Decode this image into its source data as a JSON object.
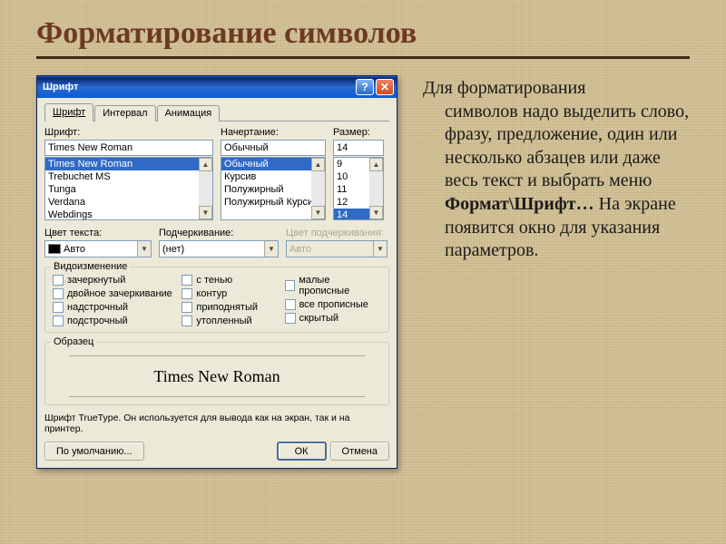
{
  "slide": {
    "title": "Форматирование символов",
    "paragraph_lead": "Для форматирования",
    "paragraph_body": "символов надо выделить слово, фразу, предложение, один или несколько абзацев или даже весь текст и выбрать меню ",
    "paragraph_bold": "Формат\\Шрифт…",
    "paragraph_tail": " На экране появится окно для указания параметров."
  },
  "dialog": {
    "title": "Шрифт",
    "help_icon": "?",
    "close_icon": "✕",
    "tabs": [
      "Шрифт",
      "Интервал",
      "Анимация"
    ],
    "font": {
      "label": "Шрифт:",
      "value": "Times New Roman",
      "options": [
        "Times New Roman",
        "Trebuchet MS",
        "Tunga",
        "Verdana",
        "Webdings"
      ]
    },
    "style": {
      "label": "Начертание:",
      "value": "Обычный",
      "options": [
        "Обычный",
        "Курсив",
        "Полужирный",
        "Полужирный Курсив"
      ]
    },
    "size": {
      "label": "Размер:",
      "value": "14",
      "options": [
        "9",
        "10",
        "11",
        "12",
        "14"
      ]
    },
    "color": {
      "label": "Цвет текста:",
      "value": "Авто"
    },
    "underline": {
      "label": "Подчеркивание:",
      "value": "(нет)"
    },
    "underline_color": {
      "label": "Цвет подчеркивания:",
      "value": "Авто"
    },
    "effects": {
      "legend": "Видоизменение",
      "col1": [
        "зачеркнутый",
        "двойное зачеркивание",
        "надстрочный",
        "подстрочный"
      ],
      "col2": [
        "с тенью",
        "контур",
        "приподнятый",
        "утопленный"
      ],
      "col3": [
        "малые прописные",
        "все прописные",
        "скрытый"
      ]
    },
    "sample": {
      "legend": "Образец",
      "text": "Times New Roman"
    },
    "hint": "Шрифт TrueType. Он используется для вывода как на экран, так и на принтер.",
    "buttons": {
      "default": "По умолчанию...",
      "ok": "ОК",
      "cancel": "Отмена"
    }
  }
}
